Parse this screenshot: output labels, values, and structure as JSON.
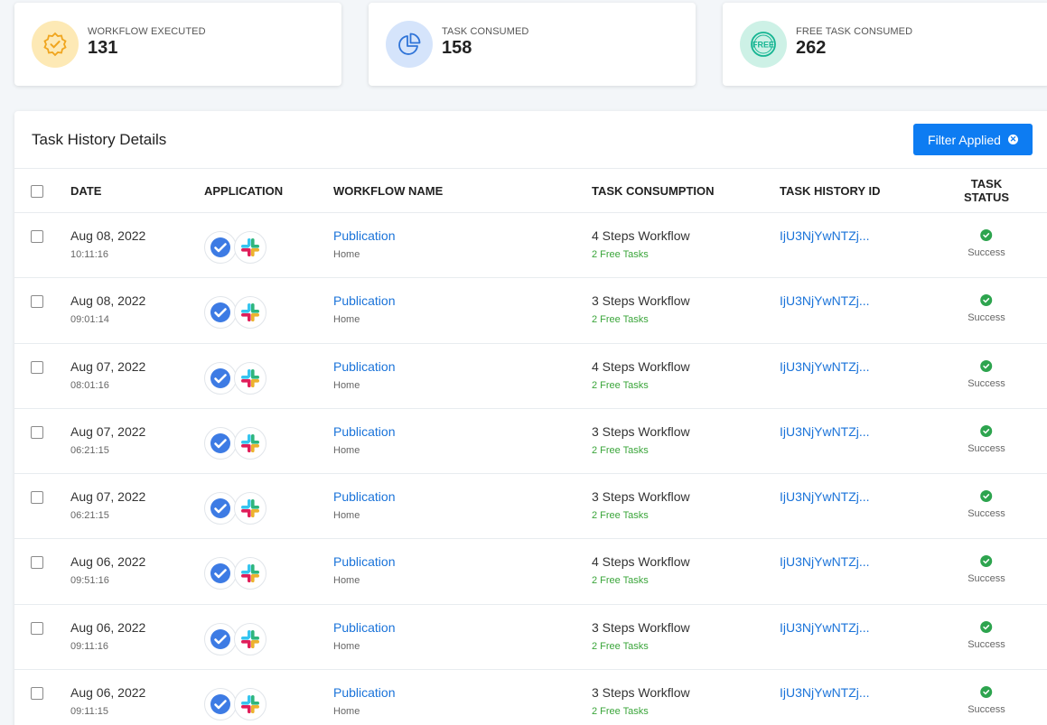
{
  "stats": [
    {
      "label": "WORKFLOW EXECUTED",
      "value": "131",
      "icon": "badge-check-icon",
      "color": "#fde9b5"
    },
    {
      "label": "TASK CONSUMED",
      "value": "158",
      "icon": "pie-chart-icon",
      "color": "#d5e4fb"
    },
    {
      "label": "FREE TASK CONSUMED",
      "value": "262",
      "icon": "free-badge-icon",
      "color": "#cdf1e6"
    }
  ],
  "panel": {
    "title": "Task History Details",
    "filter_label": "Filter Applied"
  },
  "columns": {
    "date": "DATE",
    "application": "APPLICATION",
    "workflow_name": "WORKFLOW NAME",
    "task_consumption": "TASK CONSUMPTION",
    "task_history_id": "TASK HISTORY ID",
    "task_status": "TASK STATUS"
  },
  "rows": [
    {
      "date": "Aug 08, 2022",
      "time": "10:11:16",
      "workflow": "Publication",
      "folder": "Home",
      "steps": "4 Steps Workflow",
      "free": "2 Free Tasks",
      "id": "IjU3NjYwNTZj...",
      "status": "Success"
    },
    {
      "date": "Aug 08, 2022",
      "time": "09:01:14",
      "workflow": "Publication",
      "folder": "Home",
      "steps": "3 Steps Workflow",
      "free": "2 Free Tasks",
      "id": "IjU3NjYwNTZj...",
      "status": "Success"
    },
    {
      "date": "Aug 07, 2022",
      "time": "08:01:16",
      "workflow": "Publication",
      "folder": "Home",
      "steps": "4 Steps Workflow",
      "free": "2 Free Tasks",
      "id": "IjU3NjYwNTZj...",
      "status": "Success"
    },
    {
      "date": "Aug 07, 2022",
      "time": "06:21:15",
      "workflow": "Publication",
      "folder": "Home",
      "steps": "3 Steps Workflow",
      "free": "2 Free Tasks",
      "id": "IjU3NjYwNTZj...",
      "status": "Success"
    },
    {
      "date": "Aug 07, 2022",
      "time": "06:21:15",
      "workflow": "Publication",
      "folder": "Home",
      "steps": "3 Steps Workflow",
      "free": "2 Free Tasks",
      "id": "IjU3NjYwNTZj...",
      "status": "Success"
    },
    {
      "date": "Aug 06, 2022",
      "time": "09:51:16",
      "workflow": "Publication",
      "folder": "Home",
      "steps": "4 Steps Workflow",
      "free": "2 Free Tasks",
      "id": "IjU3NjYwNTZj...",
      "status": "Success"
    },
    {
      "date": "Aug 06, 2022",
      "time": "09:11:16",
      "workflow": "Publication",
      "folder": "Home",
      "steps": "3 Steps Workflow",
      "free": "2 Free Tasks",
      "id": "IjU3NjYwNTZj...",
      "status": "Success"
    },
    {
      "date": "Aug 06, 2022",
      "time": "09:11:15",
      "workflow": "Publication",
      "folder": "Home",
      "steps": "3 Steps Workflow",
      "free": "2 Free Tasks",
      "id": "IjU3NjYwNTZj...",
      "status": "Success"
    }
  ],
  "app_icons": [
    "task-check-app-icon",
    "slack-icon"
  ]
}
